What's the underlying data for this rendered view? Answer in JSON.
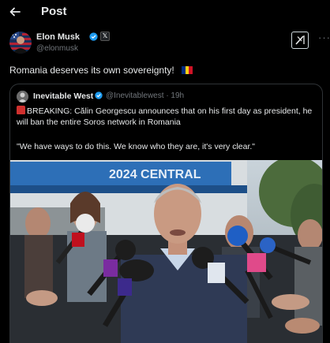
{
  "header": {
    "back_icon": "arrow-left-icon",
    "title": "Post"
  },
  "post": {
    "author_name": "Elon Musk",
    "author_handle": "@elonmusk",
    "text": "Romania deserves its own sovereignty!",
    "flag": {
      "icon": "romania-flag-icon",
      "colors": [
        "#002B7F",
        "#FCD116",
        "#CE1126"
      ]
    }
  },
  "quoted_post": {
    "author_name": "Inevitable West",
    "author_handle": "@Inevitablewest",
    "time": "19h",
    "text": "BREAKING: Călin Georgescu announces that on his first day as president, he will ban the entire Soros network in Romania",
    "quote": "\"We have ways to do this. We know who they are, it's very clear.\"",
    "photo_sign_text": "2024 CENTRAL"
  },
  "colors": {
    "background": "#000000",
    "text": "#e7e9ea",
    "muted": "#71767b",
    "verified": "#1d9bf0",
    "border": "#2f3336"
  }
}
